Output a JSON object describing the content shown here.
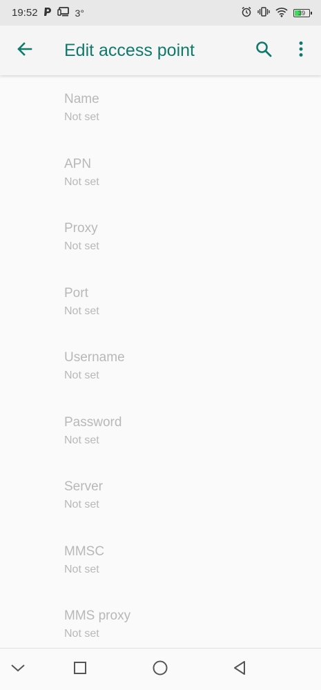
{
  "status_bar": {
    "time": "19:52",
    "temperature": "3°",
    "battery_level": "39"
  },
  "app_bar": {
    "title": "Edit access point"
  },
  "preferences": [
    {
      "title": "Name",
      "summary": "Not set"
    },
    {
      "title": "APN",
      "summary": "Not set"
    },
    {
      "title": "Proxy",
      "summary": "Not set"
    },
    {
      "title": "Port",
      "summary": "Not set"
    },
    {
      "title": "Username",
      "summary": "Not set"
    },
    {
      "title": "Password",
      "summary": "Not set"
    },
    {
      "title": "Server",
      "summary": "Not set"
    },
    {
      "title": "MMSC",
      "summary": "Not set"
    },
    {
      "title": "MMS proxy",
      "summary": "Not set"
    }
  ],
  "icons": {
    "back": "arrow-left-icon",
    "search": "search-icon",
    "more": "more-vert-icon",
    "nav_down": "chevron-down-icon",
    "nav_recents": "square-icon",
    "nav_home": "circle-icon",
    "nav_back": "triangle-back-icon"
  },
  "colors": {
    "accent": "#0f7a6b",
    "disabled_text": "#b8b8b8",
    "status_bar_bg": "#e8e8e8",
    "app_bar_bg": "#f5f5f5",
    "background": "#fafafa"
  }
}
